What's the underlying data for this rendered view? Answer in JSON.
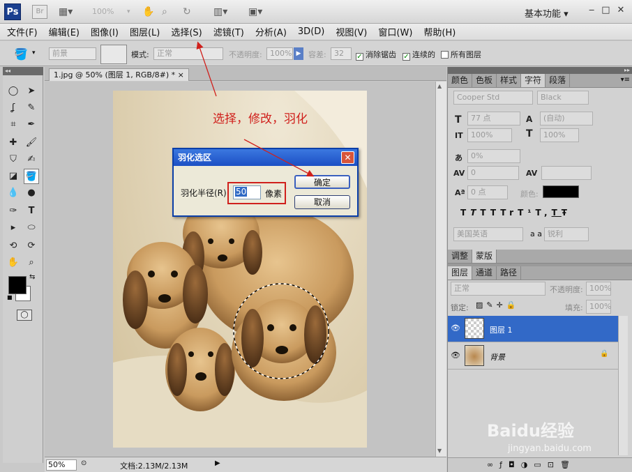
{
  "appbar": {
    "logo": "Ps",
    "bridge": "Br",
    "zoom": "100%",
    "workspace": "基本功能"
  },
  "menu": [
    "文件(F)",
    "编辑(E)",
    "图像(I)",
    "图层(L)",
    "选择(S)",
    "滤镜(T)",
    "分析(A)",
    "3D(D)",
    "视图(V)",
    "窗口(W)",
    "帮助(H)"
  ],
  "options": {
    "fill_source": "前景",
    "mode_label": "模式:",
    "mode_value": "正常",
    "opacity_label": "不透明度:",
    "opacity_value": "100%",
    "tolerance_label": "容差:",
    "tolerance_value": "32",
    "antialias": "消除锯齿",
    "contiguous": "连续的",
    "all_layers": "所有图层"
  },
  "document": {
    "tab_title": "1.jpg @ 50% (图层 1, RGB/8#) *",
    "zoom": "50%",
    "docsize": "文档:2.13M/2.13M"
  },
  "annotation": "选择，修改，羽化",
  "dialog": {
    "title": "羽化选区",
    "radius_label": "羽化半径(R):",
    "radius_value": "50",
    "unit": "像素",
    "ok": "确定",
    "cancel": "取消"
  },
  "panel_top": {
    "tabs": [
      "颜色",
      "色板",
      "样式",
      "字符",
      "段落"
    ],
    "font": "Cooper Std",
    "style": "Black",
    "size": "77 点",
    "leading": "(自动)",
    "v_scale": "100%",
    "h_scale": "100%",
    "tracking": "0%",
    "kerning": "0",
    "baseline": "0 点",
    "color_label": "颜色:",
    "type_styles": [
      "T",
      "T",
      "TT",
      "Tr",
      "T¹",
      "T,",
      "T",
      "Ŧ"
    ],
    "language": "美国英语",
    "aa_label": "a a",
    "antialias": "锐利"
  },
  "panel_adjust": {
    "tabs": [
      "调整",
      "蒙版"
    ]
  },
  "panel_layers": {
    "tabs": [
      "图层",
      "通道",
      "路径"
    ],
    "blend": "正常",
    "opacity_label": "不透明度:",
    "opacity_value": "100%",
    "lock_label": "锁定:",
    "fill_label": "填充:",
    "fill_value": "100%",
    "layers": [
      {
        "name": "图层 1",
        "selected": true
      },
      {
        "name": "背景",
        "selected": false
      }
    ]
  },
  "watermark": {
    "brand": "Baidu经验",
    "url": "jingyan.baidu.com"
  },
  "colors": {
    "selected_layer": "#3269c7",
    "annotation": "#d0201c",
    "dialog_title": "#1c4fc4"
  }
}
